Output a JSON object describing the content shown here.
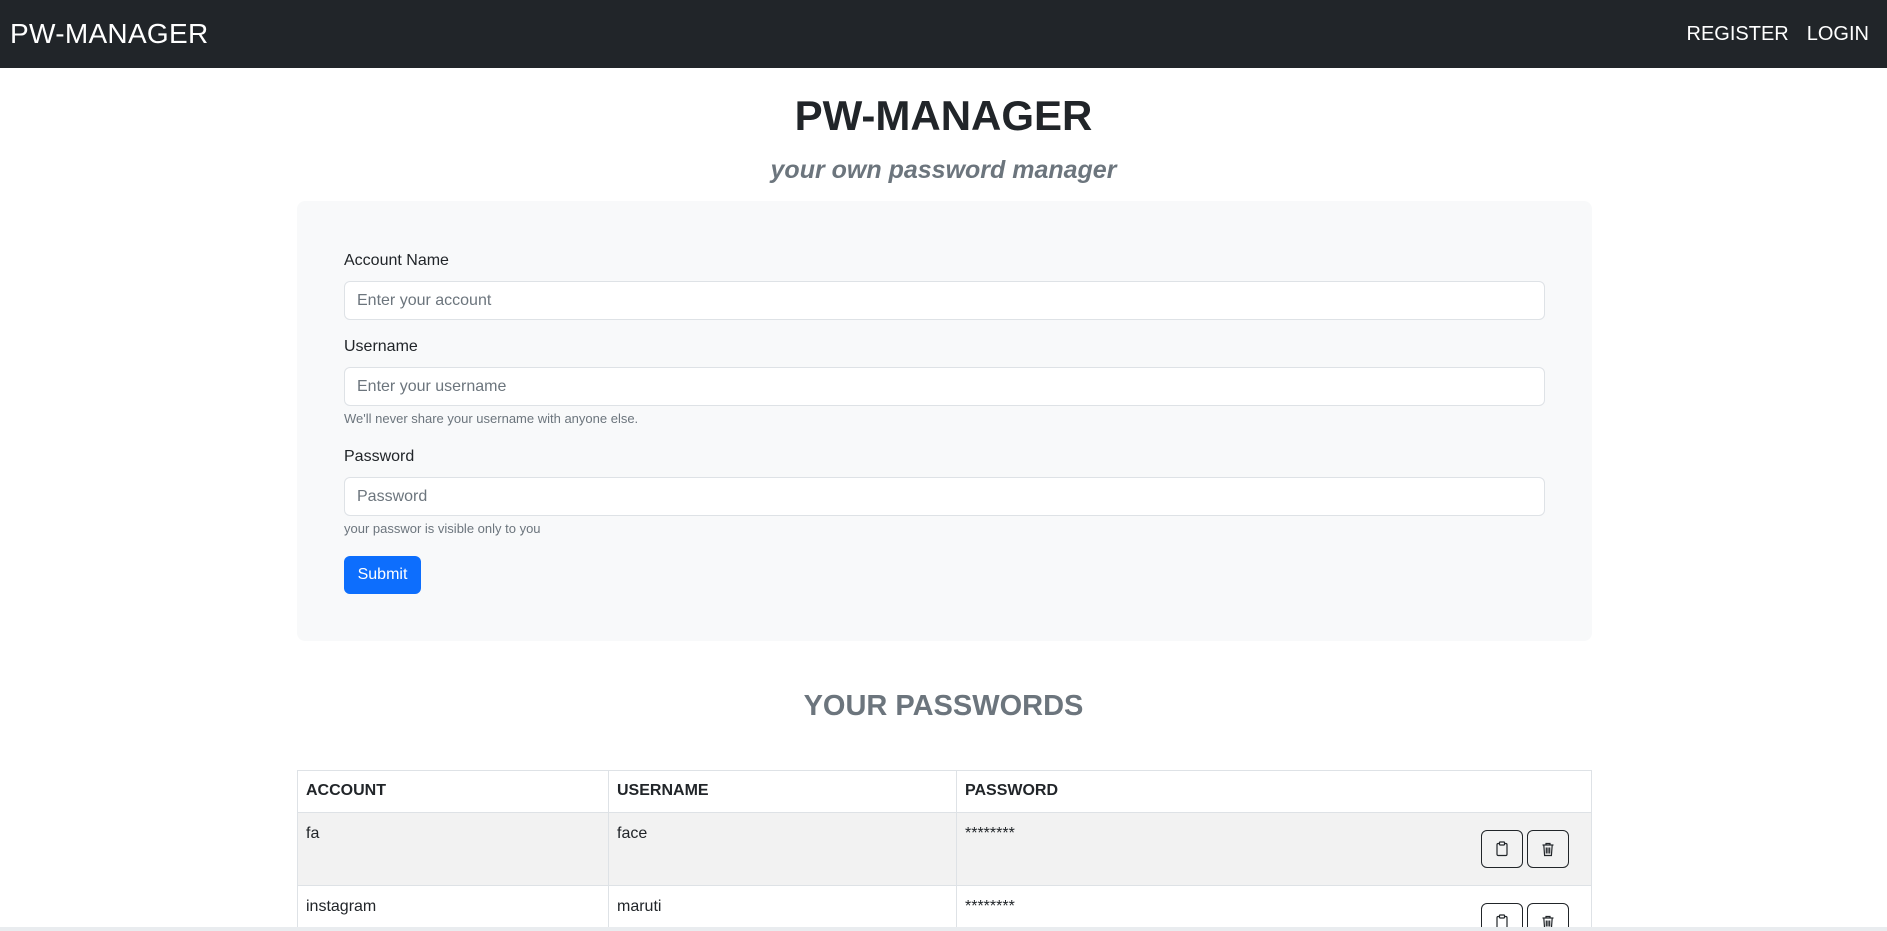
{
  "nav": {
    "brand": "PW-MANAGER",
    "links": [
      "REGISTER",
      "LOGIN"
    ]
  },
  "header": {
    "title": "PW-MANAGER",
    "subtitle": "your own password manager"
  },
  "form": {
    "account_label": "Account Name",
    "account_placeholder": "Enter your account",
    "username_label": "Username",
    "username_placeholder": "Enter your username",
    "username_help": "We'll never share your username with anyone else.",
    "password_label": "Password",
    "password_placeholder": "Password",
    "password_help": "your passwor is visible only to you",
    "submit_label": "Submit"
  },
  "passwords": {
    "section_title": "YOUR PASSWORDS",
    "columns": [
      "ACCOUNT",
      "USERNAME",
      "PASSWORD"
    ],
    "rows": [
      {
        "account": "fa",
        "username": "face",
        "password": "********"
      },
      {
        "account": "instagram",
        "username": "maruti",
        "password": "********"
      }
    ],
    "actions": [
      "clipboard-icon",
      "trash-icon"
    ]
  },
  "colors": {
    "navbar": "#212529",
    "primary": "#0d6efd",
    "muted": "#6c757d",
    "card": "#f8f9fa"
  }
}
